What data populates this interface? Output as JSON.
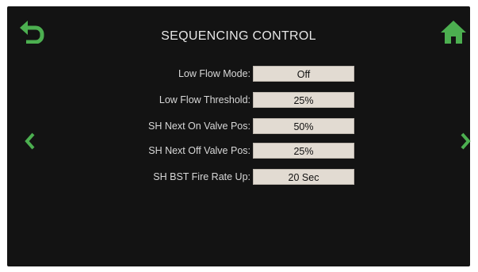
{
  "header": {
    "title": "SEQUENCING CONTROL",
    "back_icon": "back-arrow-icon",
    "home_icon": "home-icon"
  },
  "nav": {
    "prev_icon": "chevron-left-icon",
    "next_icon": "chevron-right-icon"
  },
  "colors": {
    "accent_green": "#4caf50",
    "background": "#131313",
    "field_bg": "#e2dbd2"
  },
  "settings": [
    {
      "label": "Low Flow Mode:",
      "value": "Off"
    },
    {
      "label": "Low Flow Threshold:",
      "value": "25%"
    },
    {
      "label": "SH Next On Valve Pos:",
      "value": "50%"
    },
    {
      "label": "SH Next Off Valve Pos:",
      "value": "25%"
    },
    {
      "label": "SH BST Fire Rate Up:",
      "value": "20 Sec"
    }
  ]
}
